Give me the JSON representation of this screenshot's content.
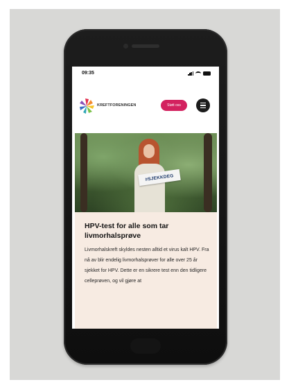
{
  "status_bar": {
    "time": "09:35"
  },
  "header": {
    "brand": "KREFTFORENINGEN",
    "cta_label": "Støtt oss"
  },
  "hero": {
    "sign_text": "#SJEKKDEG"
  },
  "article": {
    "title": "HPV-test for alle som tar livmorhalsprøve",
    "body": "Livmorhalskreft skyldes nesten alltid et virus kalt HPV. Fra nå av blir endelig livmorhalsprøver for alle over 25 år sjekket for HPV. Dette er en sikrere test enn den tidligere celleprøven, og vil gjøre at"
  },
  "colors": {
    "accent": "#d3215f",
    "card_background": "#f7ebe2",
    "backdrop": "#d8d8d6"
  }
}
